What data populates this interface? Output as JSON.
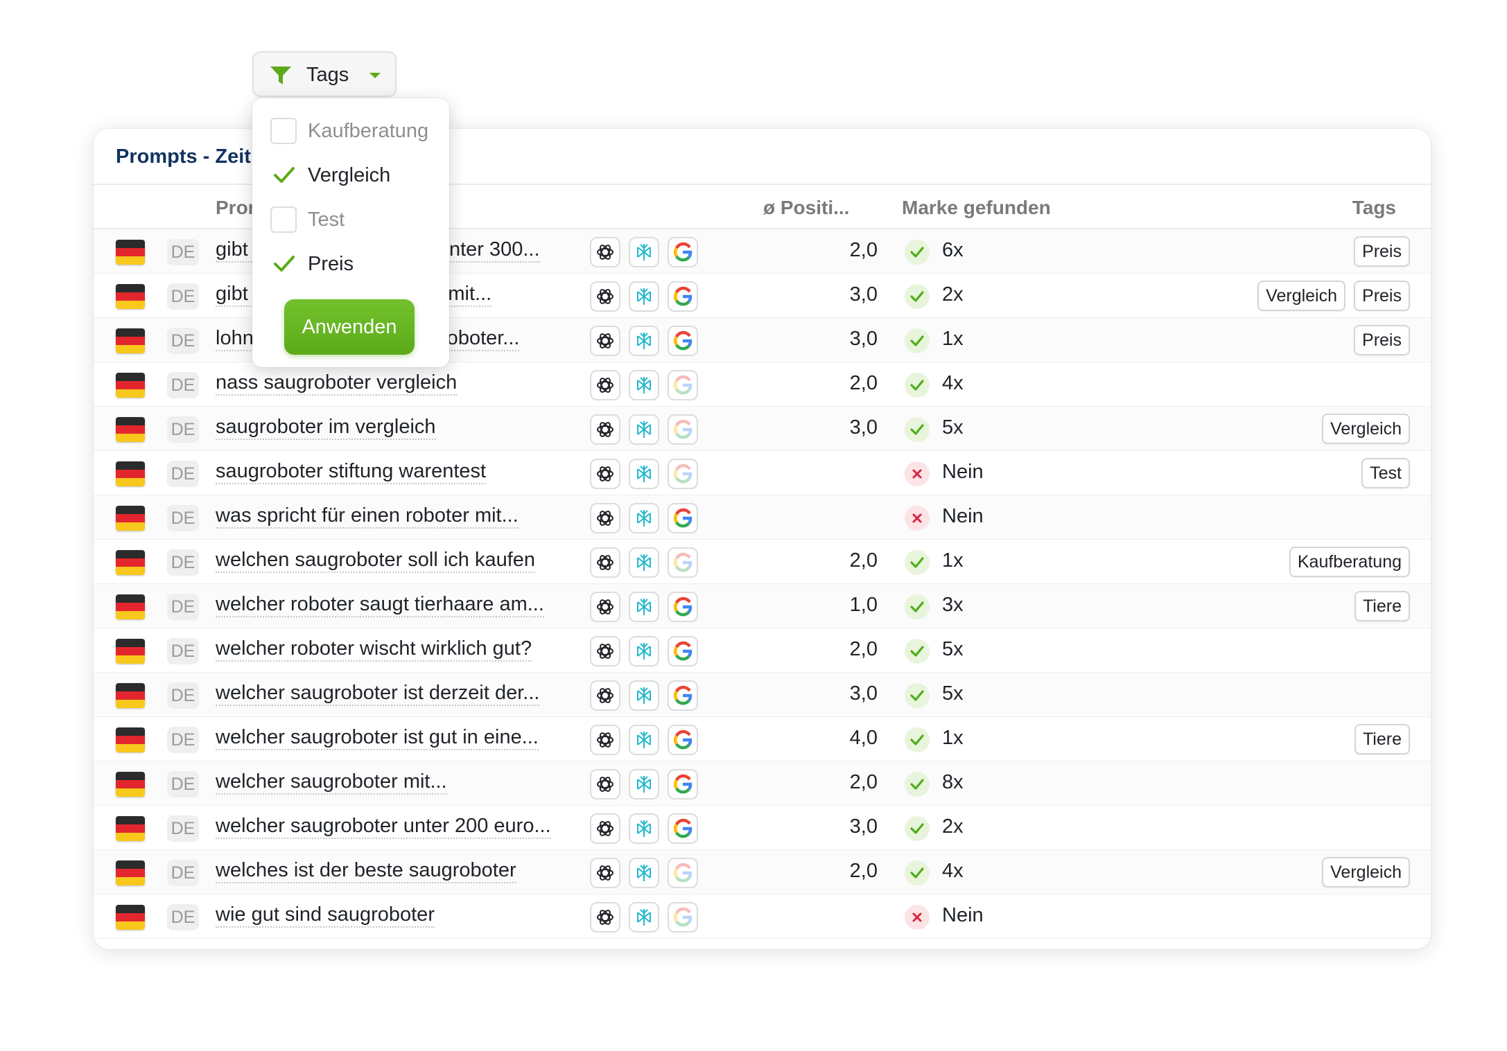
{
  "card": {
    "title": "Prompts - Zeitraum"
  },
  "columns": {
    "prompt": "Prompt",
    "position": "ø Positi...",
    "brand_found": "Marke gefunden",
    "tags": "Tags"
  },
  "filter": {
    "label": "Tags",
    "options": [
      {
        "label": "Kaufberatung",
        "checked": false
      },
      {
        "label": "Vergleich",
        "checked": true
      },
      {
        "label": "Test",
        "checked": false
      },
      {
        "label": "Preis",
        "checked": true
      }
    ],
    "apply_label": "Anwenden"
  },
  "colors": {
    "accent_green": "#5caa1a",
    "title_navy": "#12335f",
    "check_green": "#4caf1a",
    "cross_red": "#d9263d",
    "perplexity_teal": "#20b8cd"
  },
  "icons": {
    "chatgpt": "chatgpt-icon",
    "perplexity": "perplexity-icon",
    "google": "google-icon",
    "filter": "funnel-icon"
  },
  "rows": [
    {
      "country": "DE",
      "prompt": "gibt es gute saugroboter unter 300...",
      "google_active": true,
      "position": "2,0",
      "found": true,
      "found_text": "6x",
      "tags": [
        "Preis"
      ]
    },
    {
      "country": "DE",
      "prompt": "gibt es einen saugroboter mit...",
      "google_active": true,
      "position": "3,0",
      "found": true,
      "found_text": "2x",
      "tags": [
        "Vergleich",
        "Preis"
      ]
    },
    {
      "country": "DE",
      "prompt": "lohnt sich ein teurer saugroboter...",
      "google_active": true,
      "position": "3,0",
      "found": true,
      "found_text": "1x",
      "tags": [
        "Preis"
      ]
    },
    {
      "country": "DE",
      "prompt": "nass saugroboter vergleich",
      "google_active": false,
      "position": "2,0",
      "found": true,
      "found_text": "4x",
      "tags": []
    },
    {
      "country": "DE",
      "prompt": "saugroboter im vergleich",
      "google_active": false,
      "position": "3,0",
      "found": true,
      "found_text": "5x",
      "tags": [
        "Vergleich"
      ]
    },
    {
      "country": "DE",
      "prompt": "saugroboter stiftung warentest",
      "google_active": false,
      "position": "",
      "found": false,
      "found_text": "Nein",
      "tags": [
        "Test"
      ]
    },
    {
      "country": "DE",
      "prompt": "was spricht für einen roboter mit...",
      "google_active": true,
      "position": "",
      "found": false,
      "found_text": "Nein",
      "tags": []
    },
    {
      "country": "DE",
      "prompt": "welchen saugroboter soll ich kaufen",
      "google_active": false,
      "position": "2,0",
      "found": true,
      "found_text": "1x",
      "tags": [
        "Kaufberatung"
      ]
    },
    {
      "country": "DE",
      "prompt": "welcher roboter saugt tierhaare am...",
      "google_active": true,
      "position": "1,0",
      "found": true,
      "found_text": "3x",
      "tags": [
        "Tiere"
      ]
    },
    {
      "country": "DE",
      "prompt": "welcher roboter wischt wirklich gut?",
      "google_active": true,
      "position": "2,0",
      "found": true,
      "found_text": "5x",
      "tags": []
    },
    {
      "country": "DE",
      "prompt": "welcher saugroboter ist derzeit der...",
      "google_active": true,
      "position": "3,0",
      "found": true,
      "found_text": "5x",
      "tags": []
    },
    {
      "country": "DE",
      "prompt": "welcher saugroboter ist gut in eine...",
      "google_active": true,
      "position": "4,0",
      "found": true,
      "found_text": "1x",
      "tags": [
        "Tiere"
      ]
    },
    {
      "country": "DE",
      "prompt": "welcher saugroboter mit...",
      "google_active": true,
      "position": "2,0",
      "found": true,
      "found_text": "8x",
      "tags": []
    },
    {
      "country": "DE",
      "prompt": "welcher saugroboter unter 200 euro...",
      "google_active": true,
      "position": "3,0",
      "found": true,
      "found_text": "2x",
      "tags": []
    },
    {
      "country": "DE",
      "prompt": "welches ist der beste saugroboter",
      "google_active": false,
      "position": "2,0",
      "found": true,
      "found_text": "4x",
      "tags": [
        "Vergleich"
      ]
    },
    {
      "country": "DE",
      "prompt": "wie gut sind saugroboter",
      "google_active": false,
      "position": "",
      "found": false,
      "found_text": "Nein",
      "tags": []
    }
  ]
}
